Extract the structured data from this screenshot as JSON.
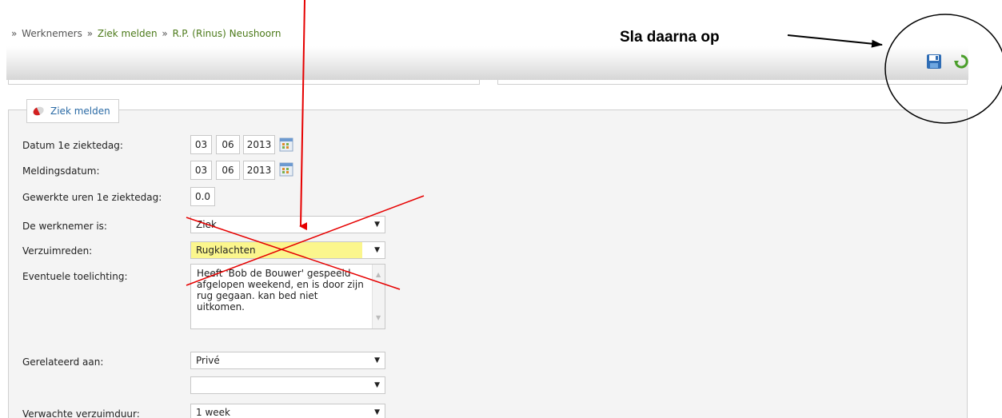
{
  "breadcrumb": {
    "prefix": "»",
    "items": [
      "Werknemers",
      "Ziek melden",
      "R.P. (Rinus) Neushoorn"
    ],
    "separator": "»"
  },
  "annotation": {
    "text": "Sla daarna op"
  },
  "toolbar": {
    "save_icon": "floppy-disk-icon",
    "refresh_icon": "refresh-icon"
  },
  "section": {
    "title": "Ziek melden",
    "icon": "pill-icon"
  },
  "form": {
    "datum_label": "Datum 1e ziektedag:",
    "datum_day": "03",
    "datum_month": "06",
    "datum_year": "2013",
    "melding_label": "Meldingsdatum:",
    "melding_day": "03",
    "melding_month": "06",
    "melding_year": "2013",
    "uren_label": "Gewerkte uren 1e ziektedag:",
    "uren_value": "0.0",
    "werknemer_label": "De werknemer is:",
    "werknemer_value": "Ziek",
    "verzuim_label": "Verzuimreden:",
    "verzuim_value": "Rugklachten",
    "toelichting_label": "Eventuele toelichting:",
    "toelichting_value": "Heeft 'Bob de Bouwer' gespeeld afgelopen weekend, en is door zijn rug gegaan. kan bed niet uitkomen.",
    "gerelateerd_label": "Gerelateerd aan:",
    "gerelateerd_value": "Privé",
    "extra_value": "",
    "verwacht_label": "Verwachte verzuimduur:",
    "verwacht_value": "1 week"
  },
  "colors": {
    "link": "#4c7a1a",
    "tab_text": "#2a6aa5",
    "highlight": "#fbf68d",
    "annotation_red": "#e60000"
  }
}
